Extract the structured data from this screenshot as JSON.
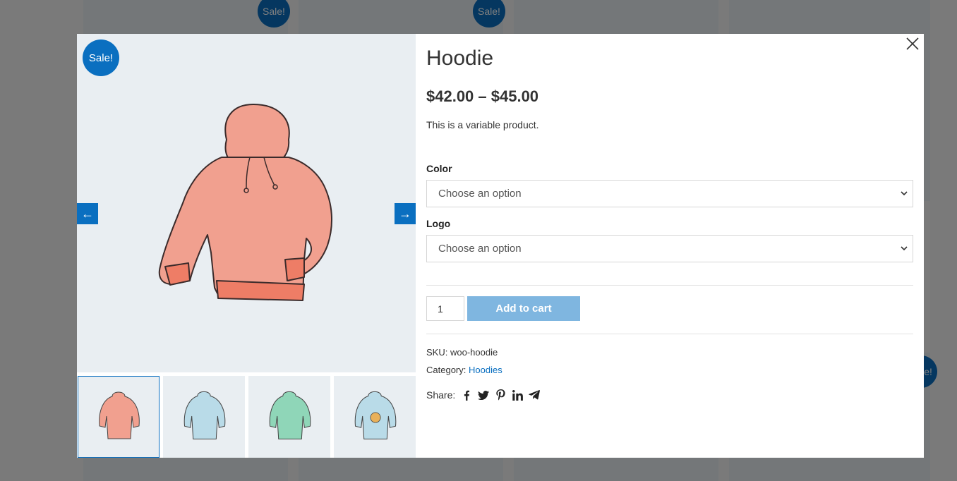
{
  "background": {
    "sale_badges": [
      "Sale!",
      "Sale!",
      "Sale!"
    ]
  },
  "modal": {
    "sale_badge": "Sale!",
    "prev_arrow": "←",
    "next_arrow": "→",
    "thumbnails": [
      {
        "color": "#f1a08f",
        "active": true
      },
      {
        "color": "#b9dbe8",
        "active": false
      },
      {
        "color": "#8fd6b8",
        "active": false
      },
      {
        "color": "#b9dbe8",
        "active": false
      }
    ],
    "product": {
      "title": "Hoodie",
      "price": "$42.00 – $45.00",
      "description": "This is a variable product.",
      "color_label": "Color",
      "color_select": "Choose an option",
      "logo_label": "Logo",
      "logo_select": "Choose an option",
      "quantity": "1",
      "add_to_cart": "Add to cart",
      "sku_label": "SKU:",
      "sku_value": "woo-hoodie",
      "category_label": "Category:",
      "category_value": "Hoodies",
      "share_label": "Share:",
      "share_icons": [
        "facebook-icon",
        "twitter-icon",
        "pinterest-icon",
        "linkedin-icon",
        "telegram-icon"
      ]
    }
  },
  "colors": {
    "accent": "#0a6fc0",
    "button_disabled": "#7fb6e0",
    "hoodie_main": "#f1a08f"
  }
}
